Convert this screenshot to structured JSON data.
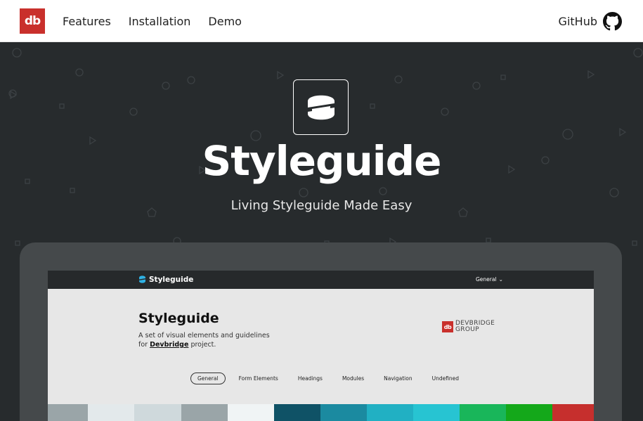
{
  "nav": {
    "logo_text": "db",
    "links": [
      "Features",
      "Installation",
      "Demo"
    ],
    "github_label": "GitHub"
  },
  "hero": {
    "title": "Styleguide",
    "subtitle": "Living Styleguide Made Easy"
  },
  "preview": {
    "brand": "Styleguide",
    "dropdown": "General",
    "title": "Styleguide",
    "desc_line1": "A set of visual elements and guidelines",
    "desc_for": "for",
    "desc_link": "Devbridge",
    "desc_end": "project.",
    "company_mark": "db",
    "company_line1": "DEVBRIDGE",
    "company_line2": "GROUP",
    "tabs": [
      "General",
      "Form Elements",
      "Headings",
      "Modules",
      "Navigation",
      "Undefined"
    ],
    "active_tab": "General"
  },
  "colors": {
    "brand_red": "#c9302c",
    "hero_bg": "#272b2d",
    "device": "#45494b",
    "swatches": [
      "#9aa5a8",
      "#e3e9eb",
      "#cfd9dc",
      "#9aa5a8",
      "#f0f4f5",
      "#0f5266",
      "#1b8aa0",
      "#21b0c3",
      "#27c4d2",
      "#19b65a",
      "#14a81a",
      "#c62f2d"
    ]
  }
}
